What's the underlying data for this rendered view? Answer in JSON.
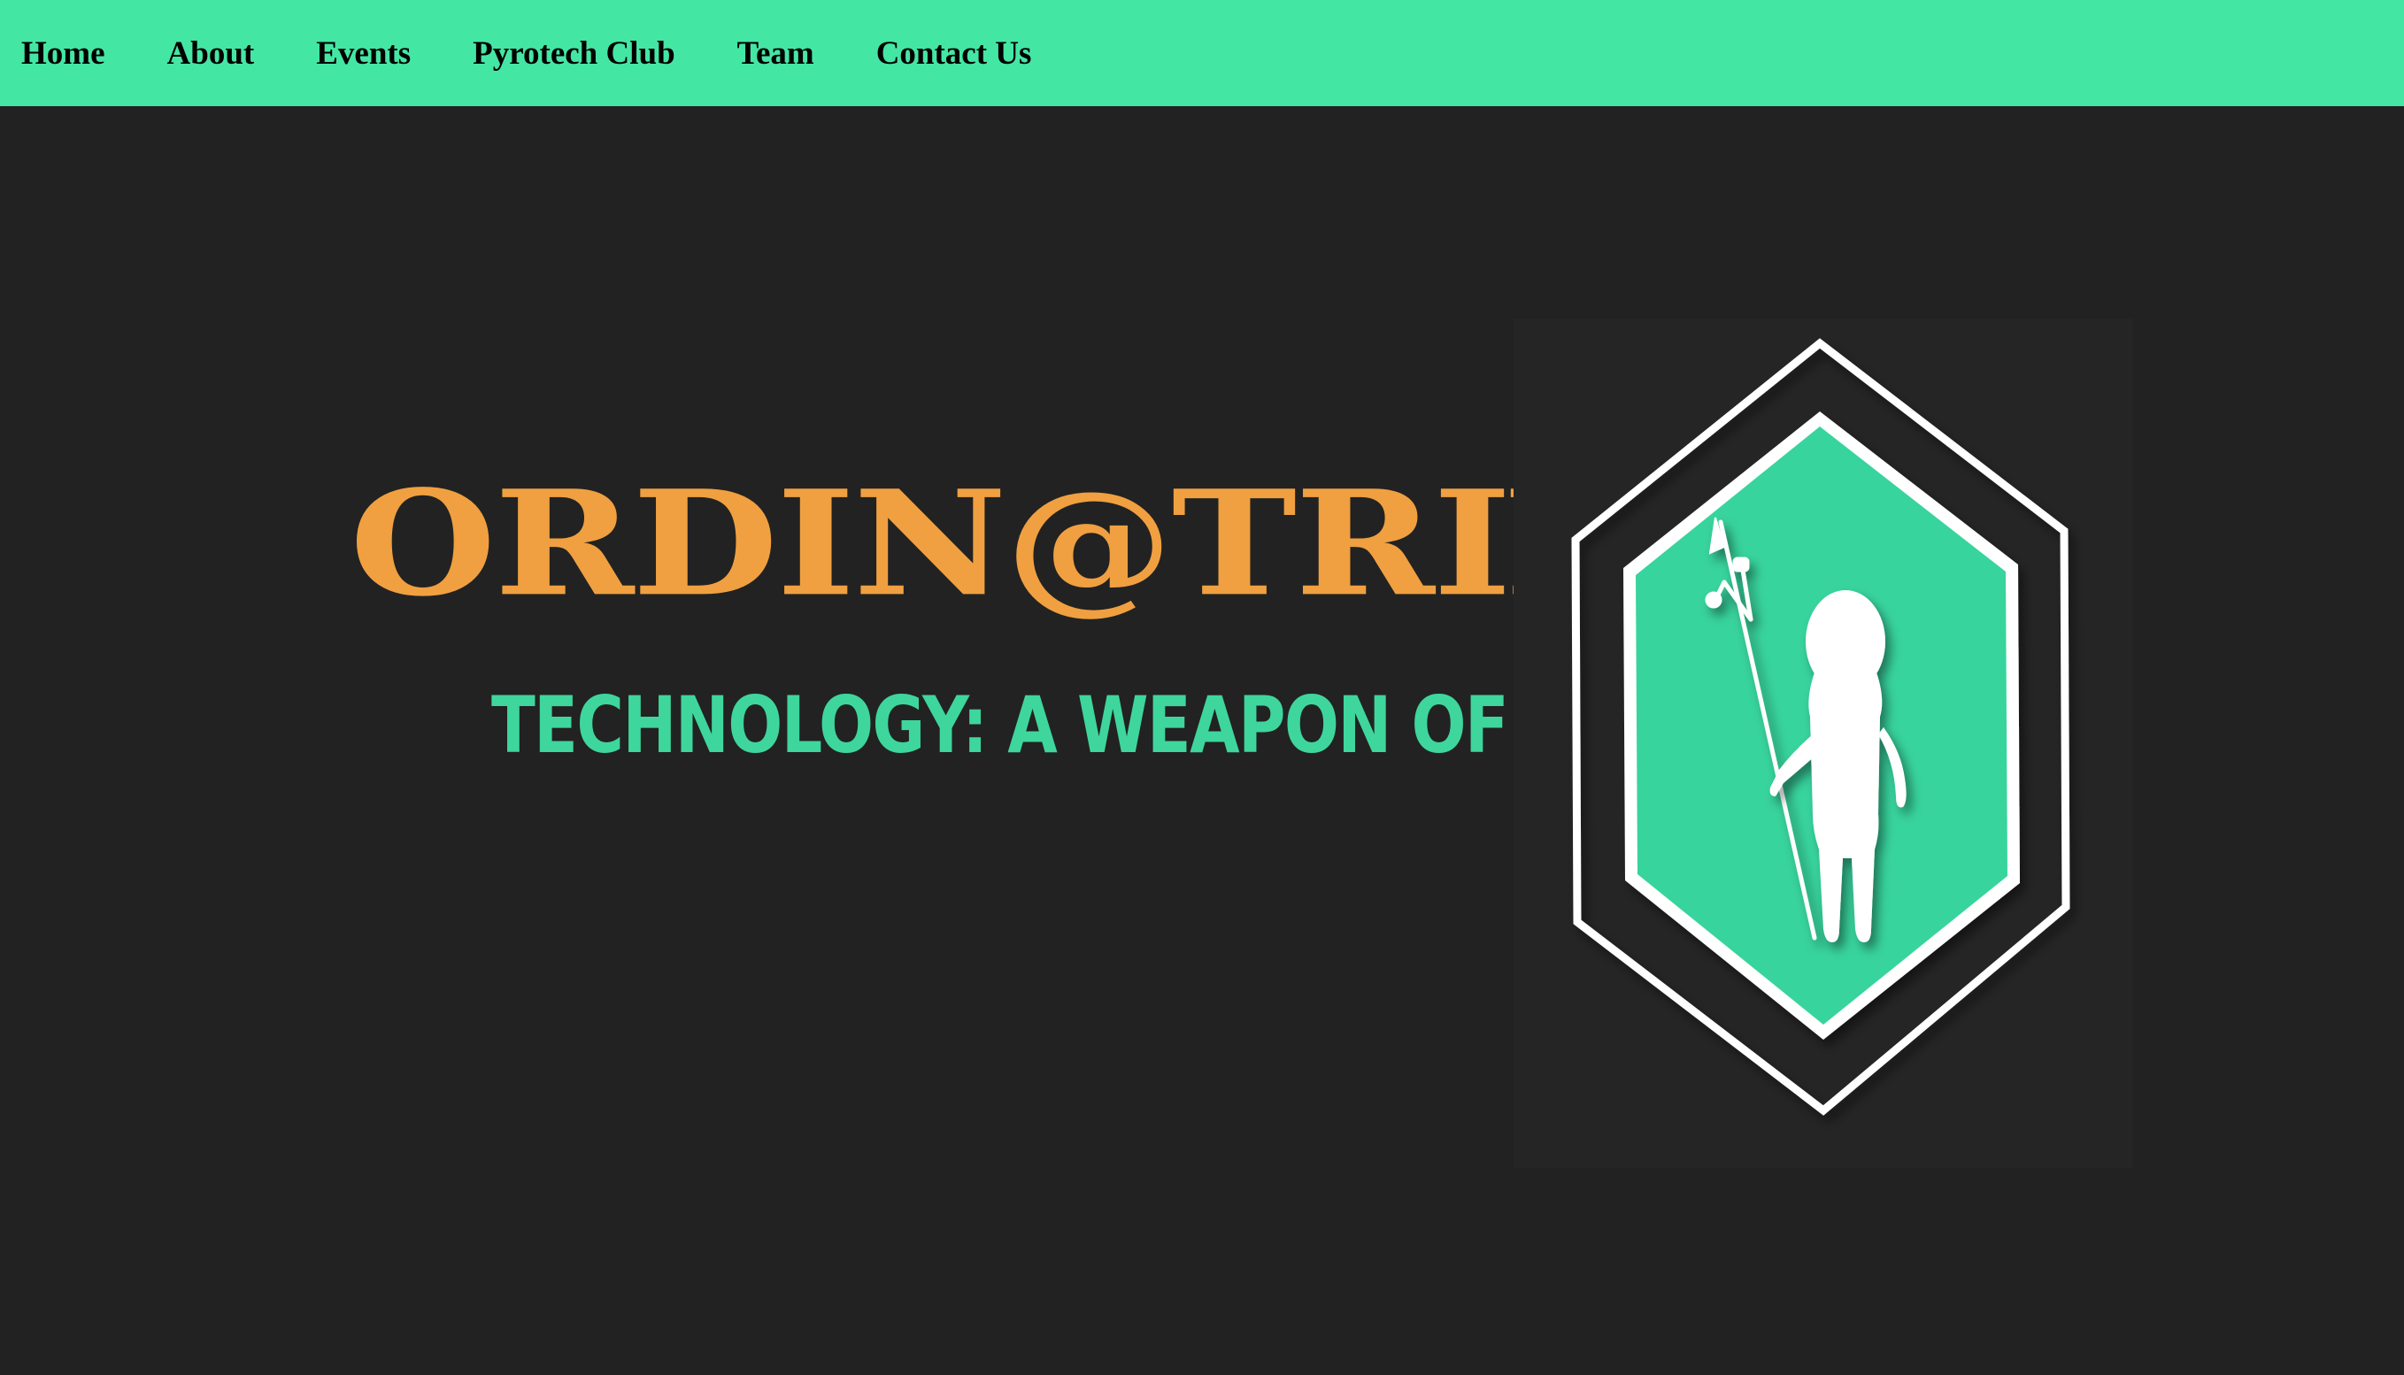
{
  "nav": {
    "items": [
      {
        "label": "Home"
      },
      {
        "label": "About"
      },
      {
        "label": "Events"
      },
      {
        "label": "Pyrotech Club"
      },
      {
        "label": "Team"
      },
      {
        "label": "Contact Us"
      }
    ]
  },
  "hero": {
    "title": "ORDIN@TRIX",
    "tagline": "TECHNOLOGY: A WEAPON OF PEACE"
  },
  "logo": {
    "icon": "hexagon-trident-figure-emblem"
  },
  "colors": {
    "nav_background": "#44e6a4",
    "page_background": "#222222",
    "title": "#f0a040",
    "tagline": "#3ed69c",
    "emblem_fill": "#38d49e"
  }
}
